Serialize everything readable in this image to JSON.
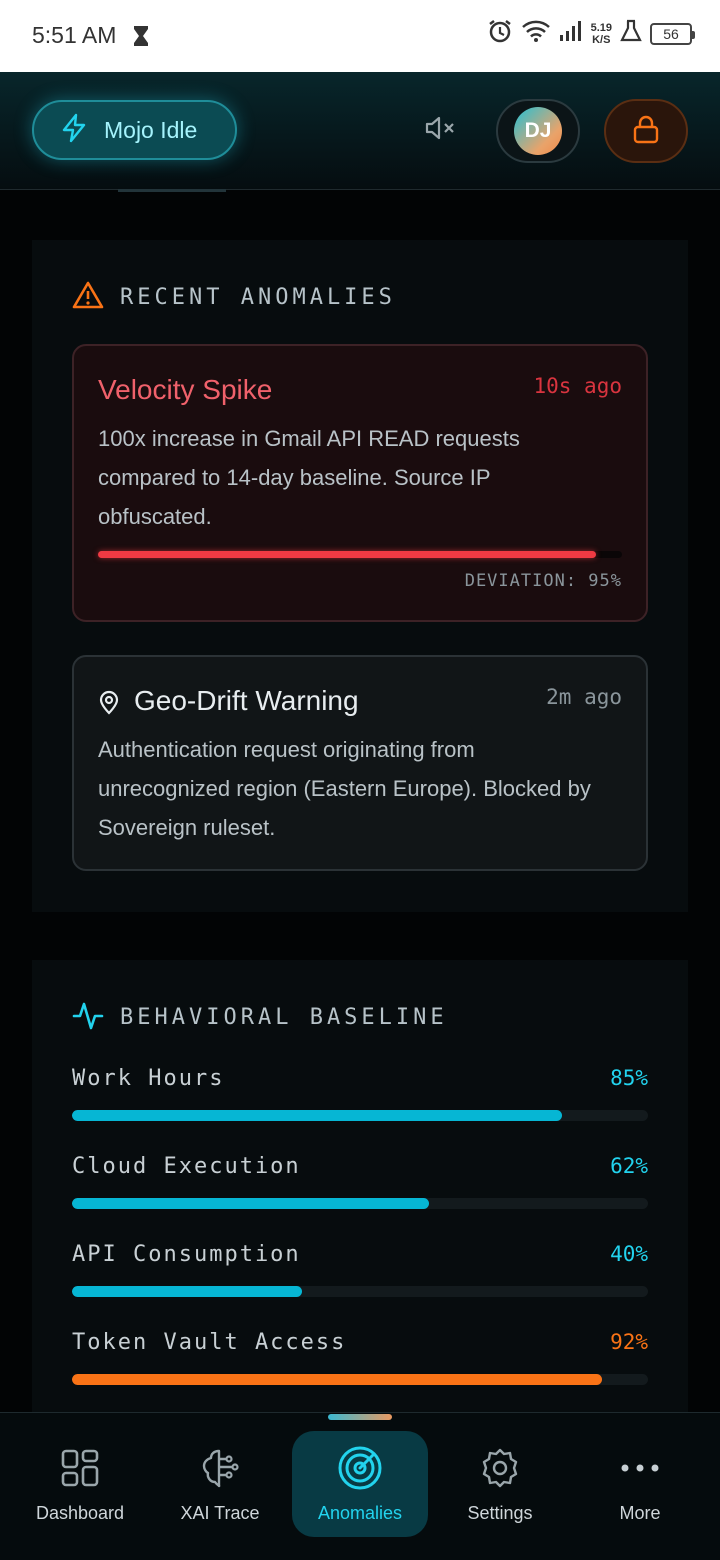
{
  "status_bar": {
    "time": "5:51 AM",
    "net_speed_value": "5.19",
    "net_speed_unit": "K/S",
    "battery": "56"
  },
  "header": {
    "mojo_label": "Mojo Idle",
    "avatar_initials": "DJ"
  },
  "anomalies": {
    "section_title": "RECENT ANOMALIES",
    "items": [
      {
        "title": "Velocity Spike",
        "time": "10s ago",
        "description": "100x increase in Gmail API READ requests compared to 14-day baseline. Source IP obfuscated.",
        "deviation_label": "DEVIATION: 95%",
        "deviation": 0.95
      },
      {
        "title": "Geo-Drift Warning",
        "time": "2m ago",
        "description": "Authentication request originating from unrecognized region (Eastern Europe). Blocked by Sovereign ruleset."
      }
    ]
  },
  "baseline": {
    "section_title": "BEHAVIORAL BASELINE",
    "metrics": [
      {
        "name": "Work Hours",
        "percent_label": "85%",
        "value": 0.85,
        "color": "#06b6d4"
      },
      {
        "name": "Cloud Execution",
        "percent_label": "62%",
        "value": 0.62,
        "color": "#06b6d4"
      },
      {
        "name": "API Consumption",
        "percent_label": "40%",
        "value": 0.4,
        "color": "#06b6d4"
      },
      {
        "name": "Token Vault Access",
        "percent_label": "92%",
        "value": 0.92,
        "color": "#f97316"
      }
    ]
  },
  "nav": {
    "items": [
      {
        "label": "Dashboard",
        "icon": "grid-icon"
      },
      {
        "label": "XAI Trace",
        "icon": "brain-circuit-icon"
      },
      {
        "label": "Anomalies",
        "icon": "radar-icon",
        "active": true
      },
      {
        "label": "Settings",
        "icon": "gear-icon"
      },
      {
        "label": "More",
        "icon": "more-dots-icon"
      }
    ]
  },
  "colors": {
    "accent_cyan": "#22d3ee",
    "danger_red": "#ef3a43",
    "warning_orange": "#f97316"
  }
}
